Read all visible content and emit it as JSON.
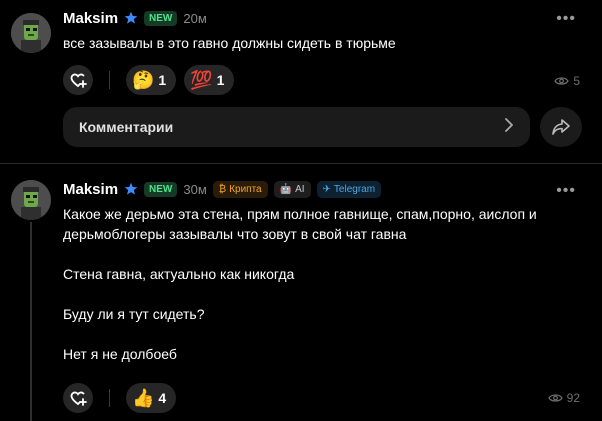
{
  "posts": [
    {
      "author": "Maksim",
      "badge": "NEW",
      "time": "20м",
      "tags": [],
      "paragraphs": [
        "все зазывалы в это гавно должны сидеть в тюрьме"
      ],
      "reactions": [
        {
          "emoji": "🤔",
          "count": "1"
        },
        {
          "emoji": "💯",
          "count": "1"
        }
      ],
      "views": "5",
      "comment_label": "Комментарии"
    },
    {
      "author": "Maksim",
      "badge": "NEW",
      "time": "30м",
      "tags": [
        {
          "label": "Крипта",
          "icon": "₿"
        },
        {
          "label": "AI",
          "icon": "🤖"
        },
        {
          "label": "Telegram",
          "icon": "✈"
        }
      ],
      "paragraphs": [
        "Какое же дерьмо эта стена, прям полное гавнище, спам,порно, аислоп и дерьмоблогеры зазывалы что зовут в свой чат гавна",
        "Стена гавна,  актуально как никогда",
        "Буду ли я тут сидеть?",
        "Нет я не долбоеб"
      ],
      "reactions": [
        {
          "emoji": "👍",
          "count": "4"
        }
      ],
      "views": "92"
    }
  ],
  "icons": {
    "verified": "verified-star-icon",
    "more": "more-dots-icon",
    "add_reaction": "heart-plus-icon",
    "views": "eye-icon",
    "chevron": "chevron-right-icon",
    "share": "share-arrow-icon"
  },
  "colors": {
    "background": "#000000",
    "badge_new": "#4ee08a",
    "verified": "#3d8bfd",
    "crypto": "#f5a623",
    "telegram": "#4aa8e8"
  }
}
